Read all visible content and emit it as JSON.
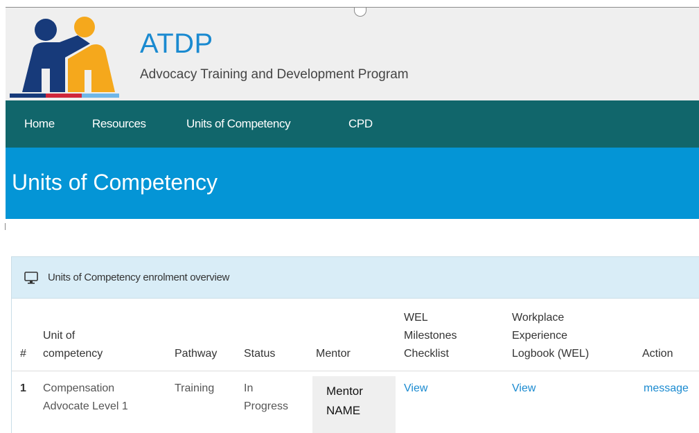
{
  "app": {
    "title": "ATDP",
    "subtitle": "Advocacy Training and Development Program"
  },
  "nav": {
    "items": [
      {
        "label": "Home"
      },
      {
        "label": "Resources"
      },
      {
        "label": "Units of Competency"
      },
      {
        "label": "CPD"
      }
    ]
  },
  "page": {
    "title": "Units of Competency"
  },
  "panel": {
    "title": "Units of Competency enrolment overview",
    "icon": "monitor-icon"
  },
  "table": {
    "headers": {
      "index": "#",
      "unit_line1": "Unit of",
      "unit_line2": "competency",
      "pathway": "Pathway",
      "status": "Status",
      "mentor": "Mentor",
      "wel_line1": "WEL",
      "wel_line2": "Milestones",
      "wel_line3": "Checklist",
      "logbook_line1": "Workplace",
      "logbook_line2": "Experience",
      "logbook_line3": "Logbook (WEL)",
      "action": "Action"
    },
    "rows": [
      {
        "index": "1",
        "unit_line1": "Compensation",
        "unit_line2": "Advocate Level 1",
        "pathway": "Training",
        "status_line1": "In",
        "status_line2": "Progress",
        "mentor_line1": "Mentor",
        "mentor_line2": "NAME",
        "wel": "View",
        "logbook": "View",
        "action": "message"
      }
    ]
  },
  "colors": {
    "brand_blue": "#1a8ad0",
    "nav_bg": "#11666b",
    "banner_bg": "#0495d6",
    "panel_heading_bg": "#d9edf7",
    "logo_navy": "#173a7a",
    "logo_orange": "#f5a81c",
    "logo_red": "#d0263b",
    "logo_lightblue": "#6fb6e8"
  }
}
